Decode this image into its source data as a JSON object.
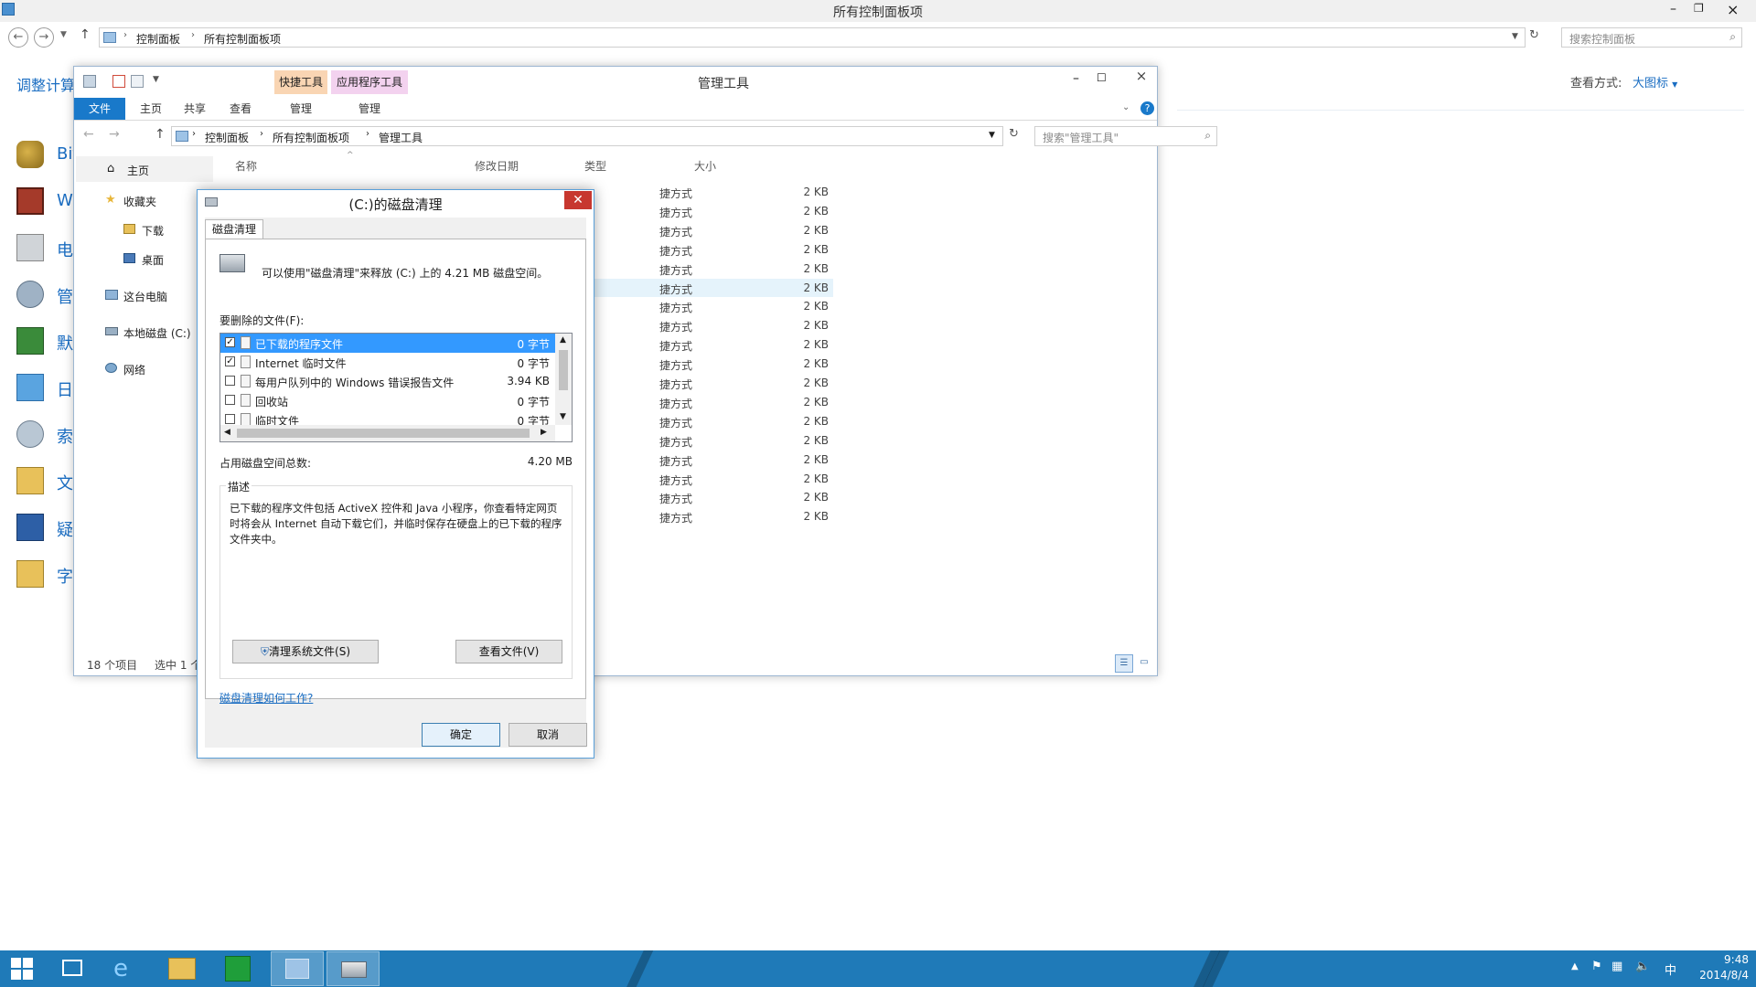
{
  "cp_window": {
    "title": "所有控制面板项",
    "breadcrumb": [
      "控制面板",
      "所有控制面板项"
    ],
    "search_placeholder": "搜索控制面板",
    "left_heading": "调整计算",
    "view_label": "查看方式:",
    "view_value": "大图标",
    "left_items": [
      "Bit",
      "Wi",
      "电",
      "管",
      "默",
      "日",
      "索",
      "文",
      "疑",
      "字"
    ]
  },
  "explorer": {
    "title": "管理工具",
    "context_tabs": [
      {
        "label": "快捷工具",
        "color": "#f9d5b3"
      },
      {
        "label": "应用程序工具",
        "color": "#f3d2ef"
      }
    ],
    "ribbon_tabs": [
      "文件",
      "主页",
      "共享",
      "查看",
      "管理",
      "管理"
    ],
    "breadcrumb": [
      "控制面板",
      "所有控制面板项",
      "管理工具"
    ],
    "search_placeholder": "搜索\"管理工具\"",
    "nav": {
      "home": "主页",
      "favorites": "收藏夹",
      "downloads": "下载",
      "desktop": "桌面",
      "this_pc": "这台电脑",
      "local_disk": "本地磁盘 (C:)",
      "network": "网络"
    },
    "columns": {
      "name": "名称",
      "modified": "修改日期",
      "type": "类型",
      "size": "大小"
    },
    "rows": [
      {
        "type": "捷方式",
        "size": "2 KB"
      },
      {
        "type": "捷方式",
        "size": "2 KB"
      },
      {
        "type": "捷方式",
        "size": "2 KB"
      },
      {
        "type": "捷方式",
        "size": "2 KB"
      },
      {
        "type": "捷方式",
        "size": "2 KB"
      },
      {
        "type": "捷方式",
        "size": "2 KB"
      },
      {
        "type": "捷方式",
        "size": "2 KB"
      },
      {
        "type": "捷方式",
        "size": "2 KB"
      },
      {
        "type": "捷方式",
        "size": "2 KB"
      },
      {
        "type": "捷方式",
        "size": "2 KB"
      },
      {
        "type": "捷方式",
        "size": "2 KB"
      },
      {
        "type": "捷方式",
        "size": "2 KB"
      },
      {
        "type": "捷方式",
        "size": "2 KB"
      },
      {
        "type": "捷方式",
        "size": "2 KB"
      },
      {
        "type": "捷方式",
        "size": "2 KB"
      },
      {
        "type": "捷方式",
        "size": "2 KB"
      },
      {
        "type": "捷方式",
        "size": "2 KB"
      },
      {
        "type": "捷方式",
        "size": "2 KB"
      }
    ],
    "status_count": "18 个项目",
    "status_selected": "选中 1 个"
  },
  "dialog": {
    "title": "(C:)的磁盘清理",
    "tab": "磁盘清理",
    "intro": "可以使用\"磁盘清理\"来释放  (C:) 上的 4.21 MB 磁盘空间。",
    "files_label": "要删除的文件(F):",
    "files": [
      {
        "name": "已下载的程序文件",
        "size": "0 字节",
        "checked": true,
        "selected": true
      },
      {
        "name": "Internet 临时文件",
        "size": "0 字节",
        "checked": true,
        "selected": false
      },
      {
        "name": "每用户队列中的 Windows 错误报告文件",
        "size": "3.94 KB",
        "checked": false,
        "selected": false
      },
      {
        "name": "回收站",
        "size": "0 字节",
        "checked": false,
        "selected": false
      },
      {
        "name": "临时文件",
        "size": "0 字节",
        "checked": false,
        "selected": false
      }
    ],
    "total_label": "占用磁盘空间总数:",
    "total_value": "4.20 MB",
    "desc_label": "描述",
    "desc_text": "已下载的程序文件包括 ActiveX 控件和 Java 小程序，你查看特定网页时将会从 Internet 自动下载它们，并临时保存在硬盘上的已下载的程序文件夹中。",
    "btn_clean_system": "清理系统文件(S)",
    "btn_view_files": "查看文件(V)",
    "link_help": "磁盘清理如何工作?",
    "btn_ok": "确定",
    "btn_cancel": "取消"
  },
  "taskbar": {
    "time": "9:48",
    "date": "2014/8/4",
    "ime": "中",
    "color": "#1f7ab8"
  }
}
